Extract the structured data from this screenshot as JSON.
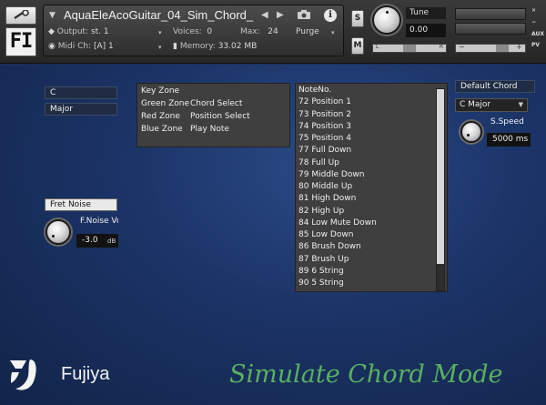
{
  "header": {
    "instrument_name": "AquaEleAcoGuitar_04_Sim_Chord_",
    "output_label": "Output:",
    "output_value": "st. 1",
    "voices_label": "Voices:",
    "voices_value": "0",
    "max_label": "Max:",
    "max_value": "24",
    "purge_label": "Purge",
    "midi_label": "Midi Ch:",
    "midi_value": "[A]  1",
    "memory_label": "Memory:",
    "memory_value": "33.02 MB",
    "solo_label": "S",
    "mute_label": "M",
    "tune_label": "Tune",
    "tune_value": "0.00",
    "pan_left": "L",
    "pan_right": "R",
    "vol_minus": "−",
    "vol_plus": "+",
    "aux_label": "AUX",
    "pv_label": "PV",
    "logo_text": "FI"
  },
  "controls": {
    "key_value": "C",
    "scale_value": "Major",
    "fret_noise_label": "Fret Noise",
    "fnoise_knob_label": "F.Noise Vo",
    "fnoise_value": "-3.0",
    "fnoise_unit": "dB",
    "default_chord_label": "Default Chord",
    "chord_select_value": "C Major",
    "speed_label": "S.Speed",
    "speed_value": "5000 ms"
  },
  "key_zone": {
    "title": "Key Zone",
    "rows": [
      {
        "zone": "Green Zone",
        "action": "Chord Select"
      },
      {
        "zone": "Red Zone",
        "action": "Position Select"
      },
      {
        "zone": "Blue Zone",
        "action": "Play Note"
      }
    ]
  },
  "note_list": {
    "header": "NoteNo.",
    "items": [
      "72  Position 1",
      "73  Position 2",
      "74  Position 3",
      "75  Position 4",
      "77  Full Down",
      "78  Full Up",
      "79  Middle Down",
      "80  Middle Up",
      "81  High Down",
      "82  High Up",
      "84  Low Mute Down",
      "85  Low Down",
      "86  Brush Down",
      "87  Brush Up",
      "89  6 String",
      "90  5 String"
    ]
  },
  "footer": {
    "brand": "Fujiya",
    "mode_title": "Simulate Chord Mode"
  },
  "colors": {
    "background": "#1b3366",
    "mode_title": "#58b060",
    "panel": "#3f3f3f"
  }
}
